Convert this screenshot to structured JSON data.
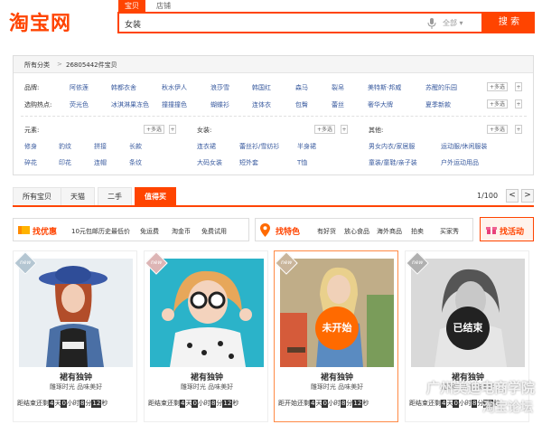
{
  "header": {
    "logo": "淘宝网",
    "tab_baobei": "宝贝",
    "tab_dianpu": "店铺",
    "search_value": "女装",
    "category_select": "全部 ▾",
    "search_button": "搜 索"
  },
  "breadcrumb": {
    "root": "所有分类",
    "sep": ">",
    "count": "26805442件宝贝"
  },
  "filters": {
    "brand_label": "品牌:",
    "brands": [
      "阿依莲",
      "韩都衣舍",
      "秋水伊人",
      "浪莎雪",
      "韩国红",
      "森马",
      "裂帛",
      "美特斯·邦威",
      "苏醒的乐园"
    ],
    "hot_label": "选购热点:",
    "hots": [
      "荧光色",
      "冰淇淋果冻色",
      "撞撞撞色",
      "蝴蝶衫",
      "连体衣",
      "包臀",
      "蕾丝",
      "奢华大牌",
      "夏季新款"
    ],
    "more": "+多选",
    "plus": "+",
    "style_label": "元素:",
    "styles": [
      "修身",
      "豹纹",
      "拼接",
      "长款",
      "碎花",
      "印花",
      "连帽",
      "条纹"
    ],
    "women_label": "女装:",
    "women": [
      "连衣裙",
      "蕾丝衫/雪纺衫",
      "半身裙",
      "大码女装",
      "短外套",
      "T恤"
    ],
    "other_label": "其他:",
    "others": [
      "男女内衣/家居服",
      "运动服/休闲服装",
      "童装/童鞋/亲子装",
      "户外运动用品"
    ]
  },
  "result_tabs": [
    "所有宝贝",
    "天猫",
    "二手",
    "值得买"
  ],
  "pager": {
    "text": "1/100",
    "prev": "<",
    "next": ">"
  },
  "promo": {
    "discount_title": "找优惠",
    "discount_items": [
      "10元包邮",
      "历史最低价",
      "免运费",
      "淘金币",
      "免费试用"
    ],
    "special_title": "找特色",
    "special_items": [
      "有好货",
      "放心食品",
      "海外商品",
      "拍卖",
      "买家秀"
    ],
    "activity_title": "找活动"
  },
  "cards": [
    {
      "title": "裙有独钟",
      "sub": "雕琢时光 品味美好",
      "prefix": "距结束还剩",
      "d": "4",
      "h": "0",
      "m": "8",
      "s": "12",
      "status": "",
      "new_tag": "new"
    },
    {
      "title": "裙有独钟",
      "sub": "雕琢时光 品味美好",
      "prefix": "距结束还剩",
      "d": "4",
      "h": "0",
      "m": "8",
      "s": "12",
      "status": "",
      "new_tag": "new"
    },
    {
      "title": "裙有独钟",
      "sub": "雕琢时光 品味美好",
      "prefix": "距开始还剩",
      "d": "4",
      "h": "0",
      "m": "8",
      "s": "12",
      "status": "未开始",
      "new_tag": "new"
    },
    {
      "title": "裙有独钟",
      "sub": "雕琢时光 品味美好",
      "prefix": "距结束还剩",
      "d": "4",
      "h": "0",
      "m": "8",
      "s": "12",
      "status": "已结束",
      "new_tag": "new"
    }
  ],
  "units": {
    "d": "天",
    "h": "小时",
    "m": "分",
    "s": "秒"
  },
  "watermark": {
    "line1": "广州美迪电商学院",
    "line2": "淘宝论坛"
  },
  "colors": {
    "accent": "#ff4400",
    "link": "#3a5b9f"
  }
}
